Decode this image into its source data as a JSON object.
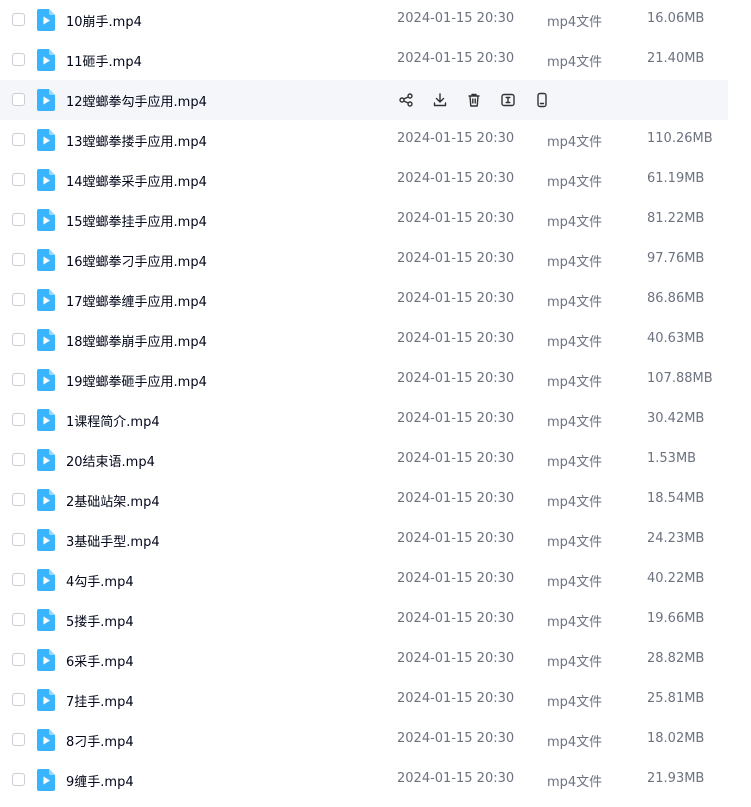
{
  "colors": {
    "file_icon": "#3bb4ff",
    "hover_bg": "#f5f6fa"
  },
  "file_icon": "video-file-icon",
  "hover_actions": [
    "share-icon",
    "download-icon",
    "delete-icon",
    "rename-icon",
    "phone-icon"
  ],
  "files": [
    {
      "name": "10崩手.mp4",
      "date": "2024-01-15 20:30",
      "type": "mp4文件",
      "size": "16.06MB"
    },
    {
      "name": "11砸手.mp4",
      "date": "2024-01-15 20:30",
      "type": "mp4文件",
      "size": "21.40MB"
    },
    {
      "name": "12螳螂拳勾手应用.mp4",
      "date": "2024-01-15 20:30",
      "type": "mp4文件",
      "size": "",
      "hovered": true
    },
    {
      "name": "13螳螂拳搂手应用.mp4",
      "date": "2024-01-15 20:30",
      "type": "mp4文件",
      "size": "110.26MB"
    },
    {
      "name": "14螳螂拳采手应用.mp4",
      "date": "2024-01-15 20:30",
      "type": "mp4文件",
      "size": "61.19MB"
    },
    {
      "name": "15螳螂拳挂手应用.mp4",
      "date": "2024-01-15 20:30",
      "type": "mp4文件",
      "size": "81.22MB"
    },
    {
      "name": "16螳螂拳刁手应用.mp4",
      "date": "2024-01-15 20:30",
      "type": "mp4文件",
      "size": "97.76MB"
    },
    {
      "name": "17螳螂拳缠手应用.mp4",
      "date": "2024-01-15 20:30",
      "type": "mp4文件",
      "size": "86.86MB"
    },
    {
      "name": "18螳螂拳崩手应用.mp4",
      "date": "2024-01-15 20:30",
      "type": "mp4文件",
      "size": "40.63MB"
    },
    {
      "name": "19螳螂拳砸手应用.mp4",
      "date": "2024-01-15 20:30",
      "type": "mp4文件",
      "size": "107.88MB"
    },
    {
      "name": "1课程简介.mp4",
      "date": "2024-01-15 20:30",
      "type": "mp4文件",
      "size": "30.42MB"
    },
    {
      "name": "20结束语.mp4",
      "date": "2024-01-15 20:30",
      "type": "mp4文件",
      "size": "1.53MB"
    },
    {
      "name": "2基础站架.mp4",
      "date": "2024-01-15 20:30",
      "type": "mp4文件",
      "size": "18.54MB"
    },
    {
      "name": "3基础手型.mp4",
      "date": "2024-01-15 20:30",
      "type": "mp4文件",
      "size": "24.23MB"
    },
    {
      "name": "4勾手.mp4",
      "date": "2024-01-15 20:30",
      "type": "mp4文件",
      "size": "40.22MB"
    },
    {
      "name": "5搂手.mp4",
      "date": "2024-01-15 20:30",
      "type": "mp4文件",
      "size": "19.66MB"
    },
    {
      "name": "6采手.mp4",
      "date": "2024-01-15 20:30",
      "type": "mp4文件",
      "size": "28.82MB"
    },
    {
      "name": "7挂手.mp4",
      "date": "2024-01-15 20:30",
      "type": "mp4文件",
      "size": "25.81MB"
    },
    {
      "name": "8刁手.mp4",
      "date": "2024-01-15 20:30",
      "type": "mp4文件",
      "size": "18.02MB"
    },
    {
      "name": "9缠手.mp4",
      "date": "2024-01-15 20:30",
      "type": "mp4文件",
      "size": "21.93MB"
    }
  ]
}
